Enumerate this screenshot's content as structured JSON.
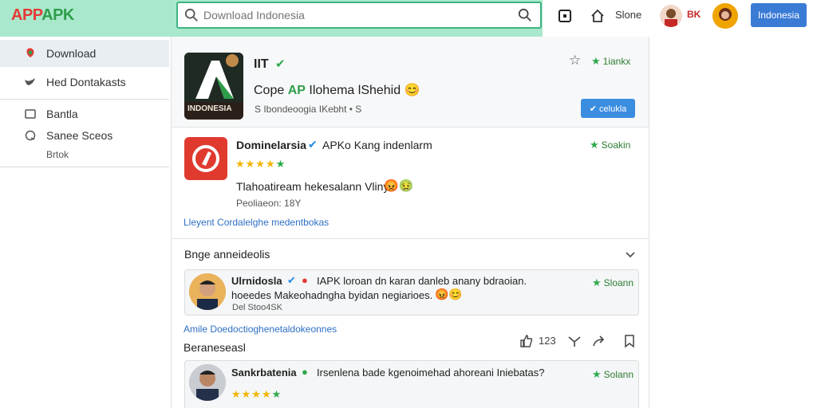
{
  "header": {
    "logo_part1": "APP",
    "logo_part2": "APK",
    "search_placeholder": "Download Indonesia",
    "slone_label": "Slone",
    "user_label": "BK",
    "indonesia_button": "Indonesia"
  },
  "sidebar": {
    "items": [
      {
        "label": "Download"
      },
      {
        "label": "Hed Dontakasts"
      },
      {
        "label": "Bantla"
      },
      {
        "label": "Sanee Sceos"
      },
      {
        "label": "Brtok"
      }
    ]
  },
  "featured": {
    "icon_text": "INDONESIA",
    "name": "IIT",
    "subtitle": "Cope",
    "subtitle_highlight": "AP",
    "subtitle_rest": "Ilohema lShehid",
    "emoji": "😊",
    "meta": "S Ibondeoogia IKebht • S",
    "rating": "1iankx",
    "action_button": "celukla"
  },
  "app_item": {
    "title": "Dominelarsia",
    "title_rest": "APKo Kang indenlarm",
    "rating": "Soakin",
    "stars": "★★★★",
    "description": "Tlahoatiream hekesalann Vliny",
    "emojis": "😡🤢",
    "meta": "Peoliaeon: 18Y",
    "link": "Lleyent Cordalelghe medentbokas"
  },
  "comments_section": {
    "title": "Bnge anneideolis",
    "comments": [
      {
        "author": "Ulrnidosla",
        "text": "IAPK loroan dn karan danleb anany bdraoian.",
        "text2": "hoeedes Makeohadngha byidan negiarioes.",
        "emojis": "😡😊",
        "meta": "Del Stoo4SK",
        "rating": "Sloann"
      }
    ],
    "link": "Amile Doedoctioghenetaldokeonnes",
    "subheading": "Beraneseasl",
    "like_count": "123",
    "comment2": {
      "author": "Sankrbatenia",
      "text": "Irsenlena bade kgenoimehad ahoreani Iniebatas?",
      "stars": "★★★★",
      "rating": "Solann"
    }
  }
}
